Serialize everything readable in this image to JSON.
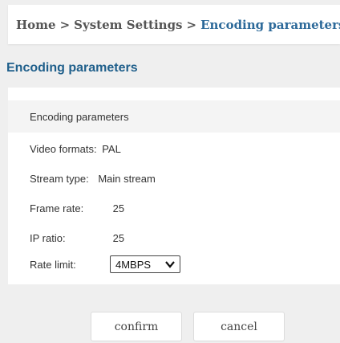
{
  "breadcrumb": {
    "items": [
      "Home",
      "System Settings",
      "Encoding parameters"
    ],
    "separator": ">"
  },
  "page_title": "Encoding parameters",
  "panel": {
    "header": "Encoding parameters",
    "fields": {
      "video_format": {
        "label": "Video formats:",
        "value": "PAL"
      },
      "stream_type": {
        "label": "Stream type:",
        "value": "Main stream"
      },
      "frame_rate": {
        "label": "Frame rate:",
        "value": "25"
      },
      "ip_ratio": {
        "label": "IP ratio:",
        "value": "25"
      },
      "rate_limit": {
        "label": "Rate limit:",
        "value": "4MBPS"
      }
    }
  },
  "buttons": {
    "confirm": "confirm",
    "cancel": "cancel"
  },
  "colors": {
    "accent": "#1f5f8b",
    "breadcrumb_current": "#2d6a9a",
    "background": "#efefef"
  },
  "icons": {
    "dropdown": "chevron-down-icon"
  }
}
